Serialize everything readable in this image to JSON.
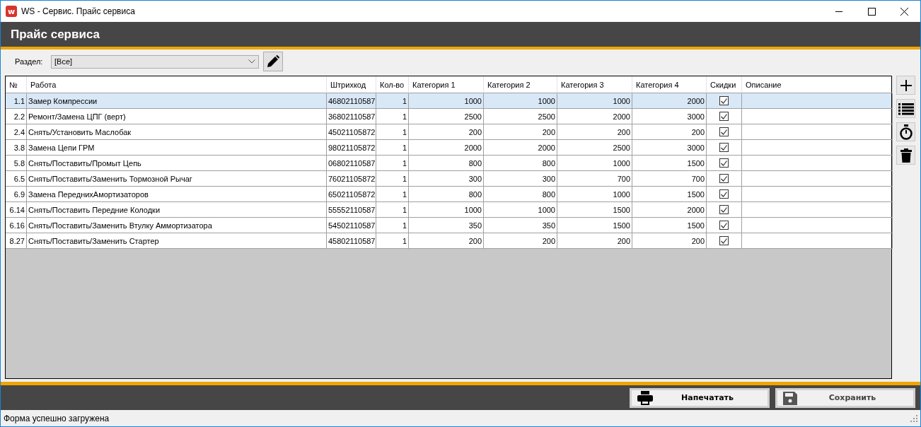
{
  "window": {
    "title": "WS - Сервис. Прайс сервиса",
    "icon_letter": "w"
  },
  "header": {
    "title": "Прайс сервиса"
  },
  "filter": {
    "label": "Раздел:",
    "value": "[Все]"
  },
  "table": {
    "columns": [
      "№",
      "Работа",
      "Штрихкод",
      "Кол-во",
      "Категория 1",
      "Категория 2",
      "Категория 3",
      "Категория 4",
      "Скидки",
      "Описание"
    ],
    "rows": [
      {
        "no": "1.1",
        "work": "Замер Компрессии",
        "barcode": "46802110587",
        "qty": "1",
        "cat1": "1000",
        "cat2": "1000",
        "cat3": "1000",
        "cat4": "2000",
        "discount": true,
        "selected": true
      },
      {
        "no": "2.2",
        "work": "Ремонт/Замена ЦПГ (верт)",
        "barcode": "36802110587",
        "qty": "1",
        "cat1": "2500",
        "cat2": "2500",
        "cat3": "2000",
        "cat4": "3000",
        "discount": true,
        "selected": false
      },
      {
        "no": "2.4",
        "work": "Снять/Установить Маслобак",
        "barcode": "45021105872",
        "qty": "1",
        "cat1": "200",
        "cat2": "200",
        "cat3": "200",
        "cat4": "200",
        "discount": true,
        "selected": false
      },
      {
        "no": "3.8",
        "work": "Замена Цепи ГРМ",
        "barcode": "98021105872",
        "qty": "1",
        "cat1": "2000",
        "cat2": "2000",
        "cat3": "2500",
        "cat4": "3000",
        "discount": true,
        "selected": false
      },
      {
        "no": "5.8",
        "work": "Снять/Поставить/Промыт Цепь",
        "barcode": "06802110587",
        "qty": "1",
        "cat1": "800",
        "cat2": "800",
        "cat3": "1000",
        "cat4": "1500",
        "discount": true,
        "selected": false
      },
      {
        "no": "6.5",
        "work": "Снять/Поставить/Заменить Тормозной Рычаг",
        "barcode": "76021105872",
        "qty": "1",
        "cat1": "300",
        "cat2": "300",
        "cat3": "700",
        "cat4": "700",
        "discount": true,
        "selected": false
      },
      {
        "no": "6.9",
        "work": "Замена ПереднихАмортизаторов",
        "barcode": "65021105872",
        "qty": "1",
        "cat1": "800",
        "cat2": "800",
        "cat3": "1000",
        "cat4": "1500",
        "discount": true,
        "selected": false
      },
      {
        "no": "6.14",
        "work": "Снять/Поставить Передние Колодки",
        "barcode": "55552110587",
        "qty": "1",
        "cat1": "1000",
        "cat2": "1000",
        "cat3": "1500",
        "cat4": "2000",
        "discount": true,
        "selected": false
      },
      {
        "no": "6.16",
        "work": "Снять/Поставить/Заменить Втулку Аммортизатора",
        "barcode": "54502110587",
        "qty": "1",
        "cat1": "350",
        "cat2": "350",
        "cat3": "1500",
        "cat4": "1500",
        "discount": true,
        "selected": false
      },
      {
        "no": "8.27",
        "work": "Снять/Поставить/Заменить Стартер",
        "barcode": "45802110587",
        "qty": "1",
        "cat1": "200",
        "cat2": "200",
        "cat3": "200",
        "cat4": "200",
        "discount": true,
        "selected": false
      }
    ]
  },
  "buttons": [
    {
      "label": "Напечатать",
      "kind": "print",
      "disabled": false
    },
    {
      "label": "Сохранить",
      "kind": "save",
      "disabled": true
    }
  ],
  "status_bar": {
    "text": "Форма успешно загружена"
  }
}
